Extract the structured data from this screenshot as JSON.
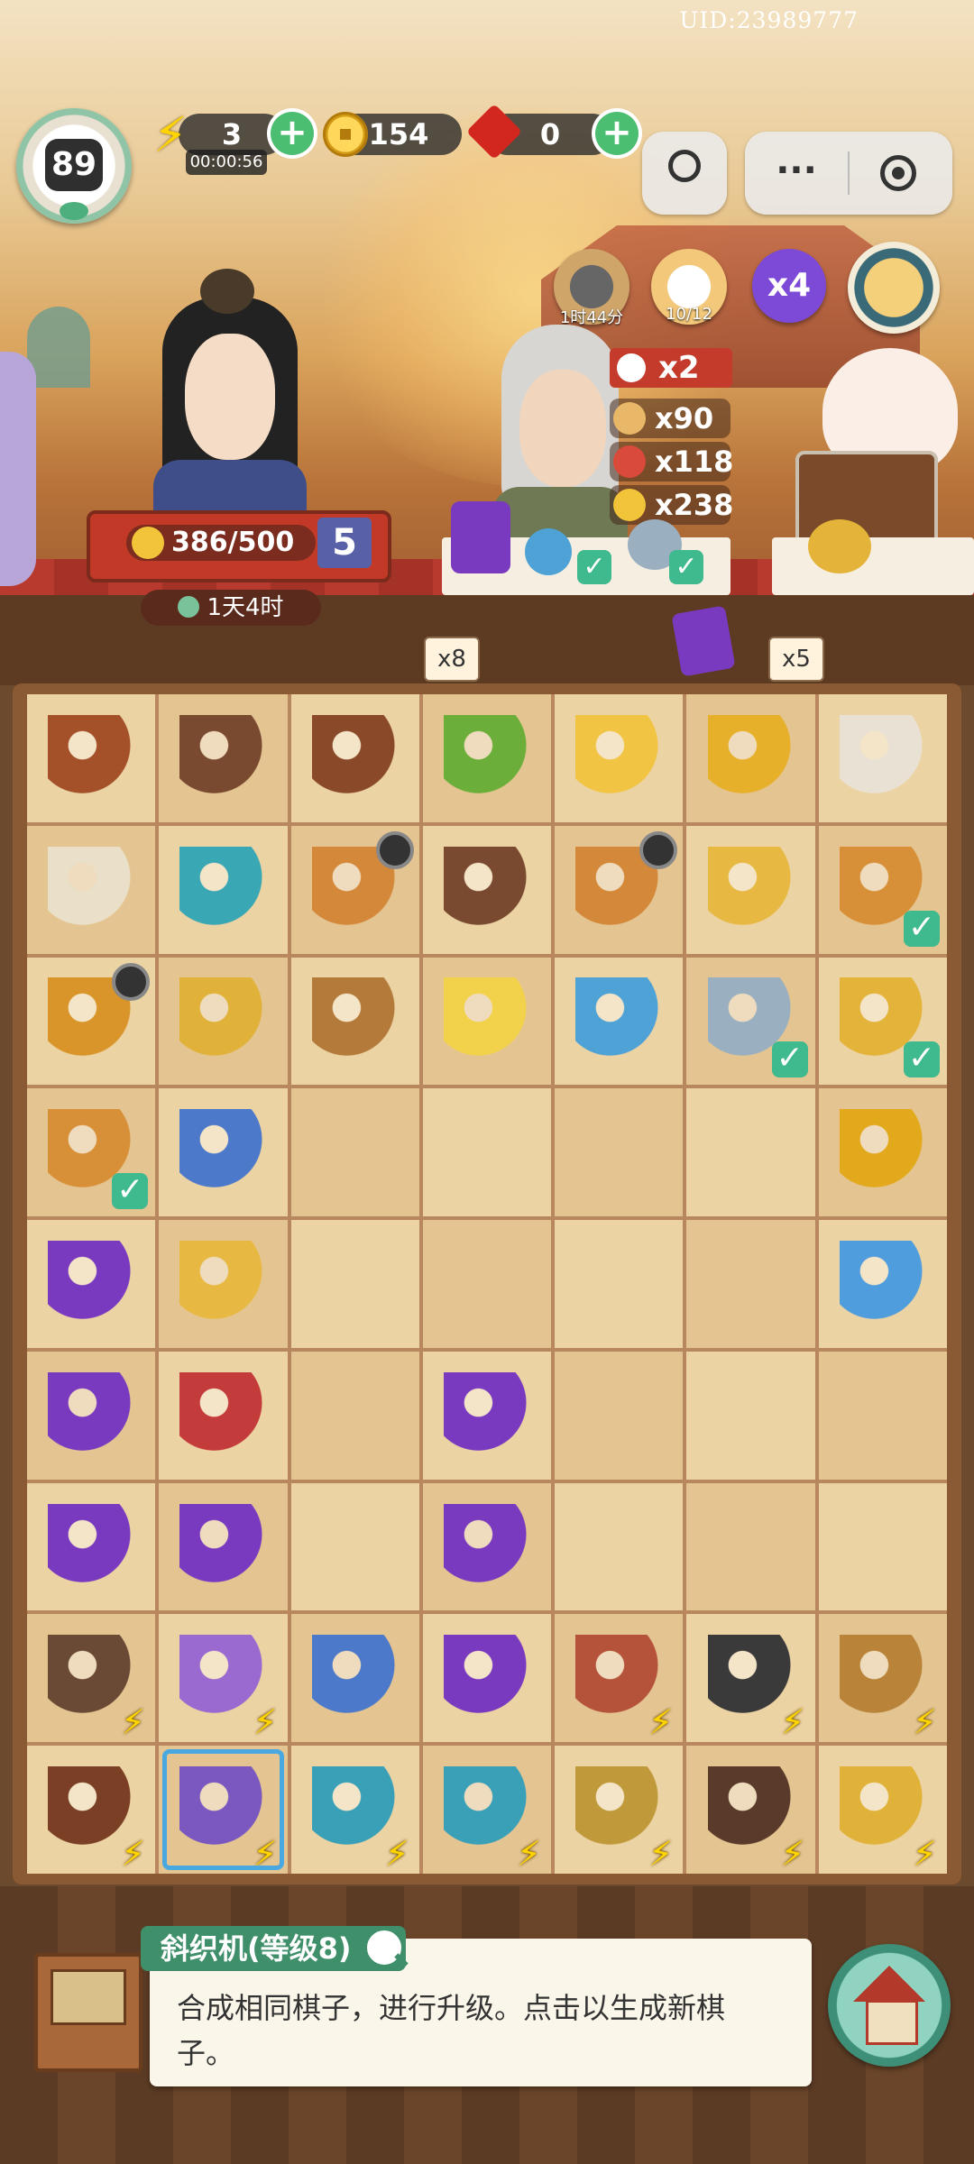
{
  "uid": "UID:23989777",
  "player": {
    "level": "89"
  },
  "resources": {
    "energy": {
      "icon": "lightning-icon",
      "value": "3",
      "timer": "00:00:56"
    },
    "coins": {
      "icon": "coin-icon",
      "value": "154"
    },
    "gems": {
      "icon": "ruby-icon",
      "value": "0"
    }
  },
  "top_buttons": {
    "menu": "···"
  },
  "events": {
    "wok_timer": "1时44分",
    "cat_count": "10/12",
    "multiplier": "x4"
  },
  "customer_left": {
    "progress": "386/500",
    "level": "5",
    "time_left": "1天4时"
  },
  "customer_center": {
    "bonus": "x2",
    "rewards": [
      "x90",
      "x118",
      "x238"
    ],
    "counter": "x8"
  },
  "customer_right": {
    "counter": "x5"
  },
  "board": {
    "rows": [
      [
        {
          "n": "cinnamon-bundle-item"
        },
        {
          "n": "wooden-tray-item"
        },
        {
          "n": "nest-item"
        },
        {
          "n": "bamboo-item"
        },
        {
          "n": "chicks-nest-item"
        },
        {
          "n": "yellow-bird-item"
        },
        {
          "n": "silk-cocoons-item"
        }
      ],
      [
        {
          "n": "cotton-spindle-item"
        },
        {
          "n": "jade-pot-item"
        },
        {
          "n": "chicken-coop-item",
          "lock": true
        },
        {
          "n": "wooden-box-item"
        },
        {
          "n": "chicken-coop-item",
          "lock": true
        },
        {
          "n": "fried-rice-bowl-item"
        },
        {
          "n": "roast-chicken-item",
          "check": true
        }
      ],
      [
        {
          "n": "hen-nest-item",
          "lock": true
        },
        {
          "n": "gold-bracelet-item"
        },
        {
          "n": "sparrow-item"
        },
        {
          "n": "egg-fried-rice-item"
        },
        {
          "n": "blue-hairpin-item"
        },
        {
          "n": "feather-item",
          "check": true
        },
        {
          "n": "earrings-item",
          "check": true
        }
      ],
      [
        {
          "n": "roast-chicken-item",
          "check": true
        },
        {
          "n": "tea-cup-item"
        },
        {
          "n": ""
        },
        {
          "n": ""
        },
        {
          "n": ""
        },
        {
          "n": ""
        },
        {
          "n": "copper-coins-item"
        }
      ],
      [
        {
          "n": "purple-handbag-item"
        },
        {
          "n": "fried-egg-item"
        },
        {
          "n": ""
        },
        {
          "n": ""
        },
        {
          "n": ""
        },
        {
          "n": ""
        },
        {
          "n": "beaded-bracelet-item"
        }
      ],
      [
        {
          "n": "embroidered-pouch-item"
        },
        {
          "n": "red-scrolls-item"
        },
        {
          "n": ""
        },
        {
          "n": "purple-compact-item"
        },
        {
          "n": ""
        },
        {
          "n": ""
        },
        {
          "n": ""
        }
      ],
      [
        {
          "n": "embroidered-pouch-item"
        },
        {
          "n": "purple-scroll-item"
        },
        {
          "n": ""
        },
        {
          "n": "purple-sachet-item"
        },
        {
          "n": ""
        },
        {
          "n": ""
        },
        {
          "n": ""
        }
      ],
      [
        {
          "n": "jewel-chest-item",
          "bolt": true
        },
        {
          "n": "spinning-wheel-item",
          "bolt": true
        },
        {
          "n": "tea-bowl-item"
        },
        {
          "n": "purple-purse-item"
        },
        {
          "n": "fruit-basket-item",
          "bolt": true
        },
        {
          "n": "jewelry-cabinet-item",
          "bolt": true
        },
        {
          "n": "scroll-basket-item",
          "bolt": true
        }
      ],
      [
        {
          "n": "bonsai-item",
          "bolt": true
        },
        {
          "n": "loom-item",
          "bolt": true,
          "sel": true
        },
        {
          "n": "teapot-set-item",
          "bolt": true
        },
        {
          "n": "teapot-item",
          "bolt": true
        },
        {
          "n": "flour-bowl-item",
          "bolt": true
        },
        {
          "n": "treasure-chest-item",
          "bolt": true
        },
        {
          "n": "gold-chest-item",
          "bolt": true
        }
      ]
    ]
  },
  "tooltip": {
    "title": "斜织机(等级8)",
    "body": "合成相同棋子，进行升级。点击以生成新棋子。"
  },
  "colors": {
    "accent_green": "#3f8f6a",
    "energy_yellow": "#ffd400",
    "check_green": "#3fb98e"
  }
}
